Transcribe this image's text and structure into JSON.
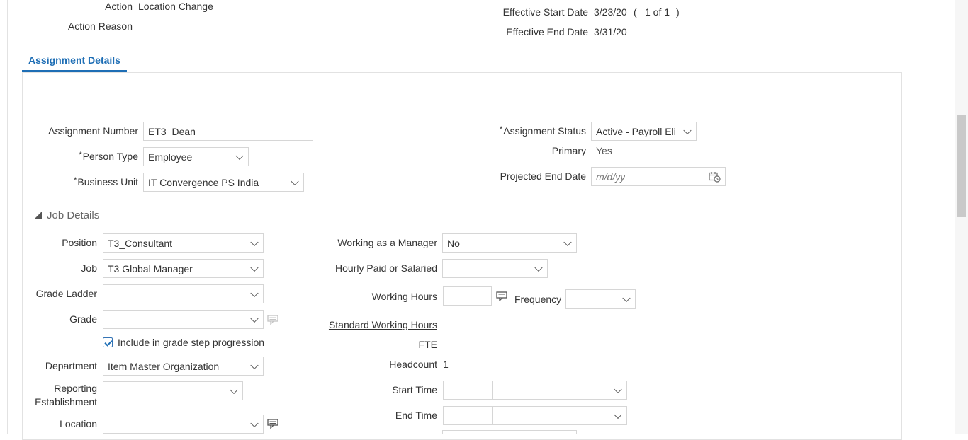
{
  "header": {
    "action_label": "Action",
    "action_value": "Location Change",
    "action_reason_label": "Action Reason",
    "effective_start_label": "Effective Start Date",
    "effective_start_value": "3/23/20",
    "record_nav_open": "(",
    "record_nav_text": "1 of 1",
    "record_nav_close": ")",
    "effective_end_label": "Effective End Date",
    "effective_end_value": "3/31/20"
  },
  "tab": {
    "label": "Assignment Details"
  },
  "assignment": {
    "number_label": "Assignment Number",
    "number_value": "ET3_Dean",
    "person_type_label": "Person Type",
    "person_type_value": "Employee",
    "business_unit_label": "Business Unit",
    "business_unit_value": "IT Convergence PS India",
    "status_label": "Assignment Status",
    "status_value": "Active - Payroll Eli",
    "primary_label": "Primary",
    "primary_value": "Yes",
    "projected_end_label": "Projected End Date",
    "projected_end_placeholder": "m/d/yy",
    "required_mark": "*"
  },
  "job_details": {
    "section_title": "Job Details",
    "position_label": "Position",
    "position_value": "T3_Consultant",
    "job_label": "Job",
    "job_value": "T3 Global Manager",
    "grade_ladder_label": "Grade Ladder",
    "grade_ladder_value": "",
    "grade_label": "Grade",
    "grade_value": "",
    "include_grade_label": "Include in grade step progression",
    "include_grade_checked": true,
    "department_label": "Department",
    "department_value": "Item Master Organization",
    "reporting_label_line1": "Reporting",
    "reporting_label_line2": "Establishment",
    "reporting_value": "",
    "location_label": "Location",
    "location_value": "",
    "manager_label": "Working as a Manager",
    "manager_value": "No",
    "hourly_label": "Hourly Paid or Salaried",
    "hourly_value": "",
    "working_hours_label": "Working Hours",
    "working_hours_value": "",
    "frequency_label": "Frequency",
    "frequency_value": "",
    "std_hours_label": "Standard Working Hours",
    "fte_label": "FTE",
    "headcount_label": "Headcount",
    "headcount_value": "1",
    "start_time_label": "Start Time",
    "end_time_label": "End Time"
  }
}
